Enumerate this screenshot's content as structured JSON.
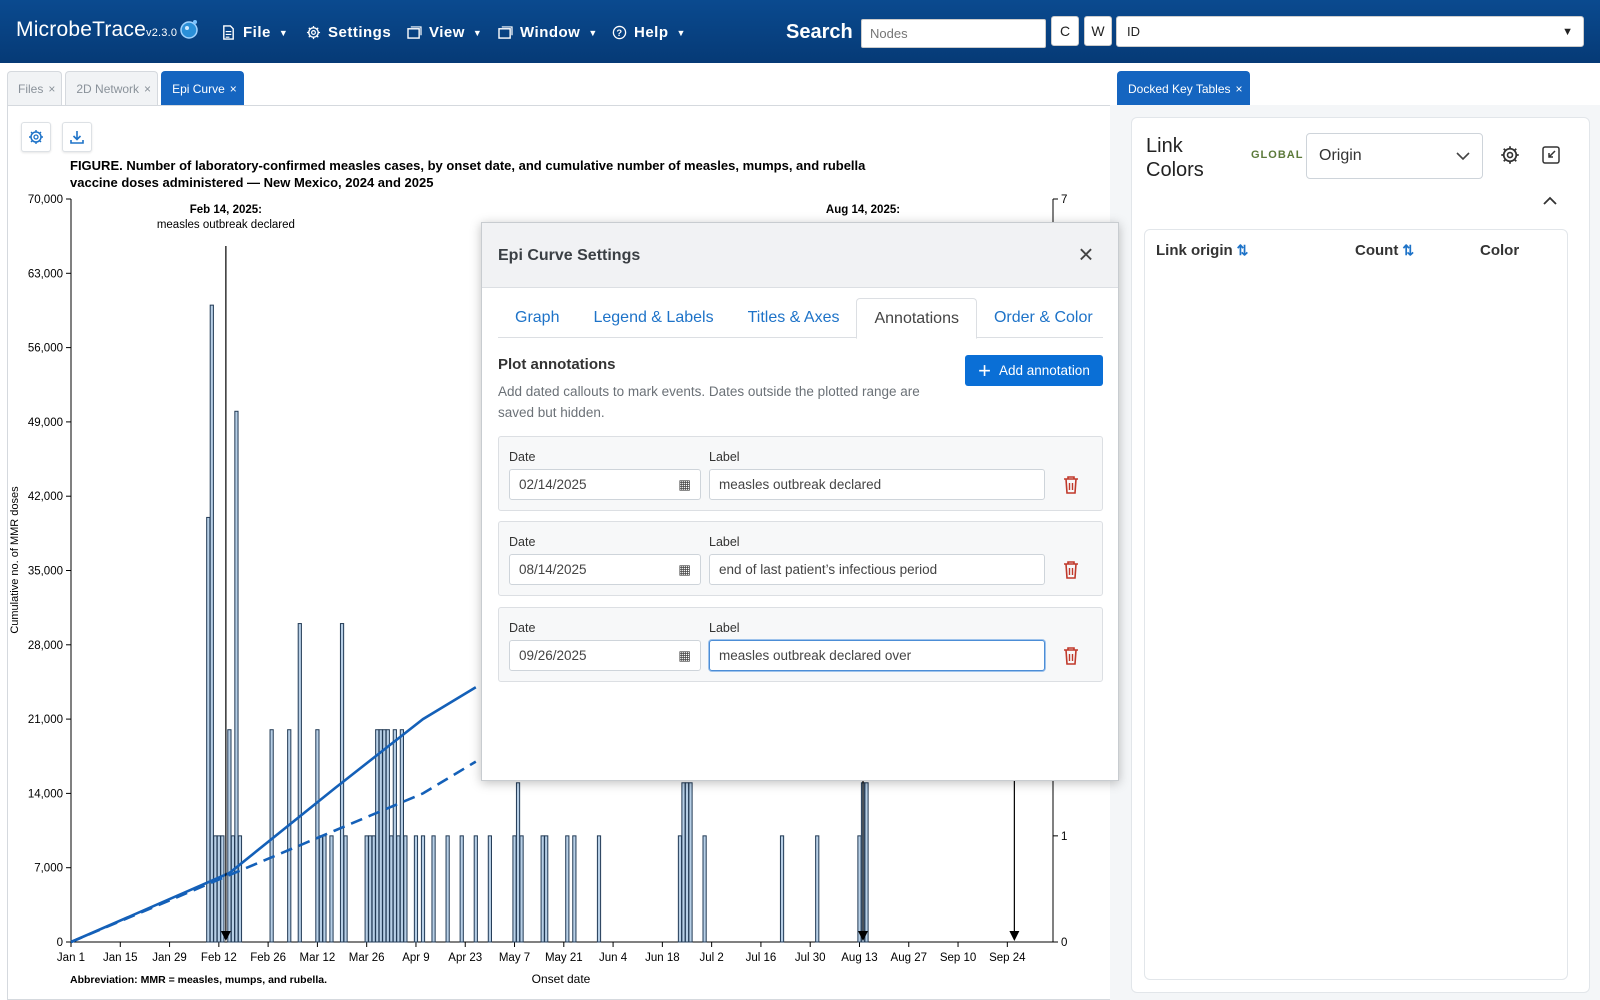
{
  "navbar": {
    "brand": "MicrobeTrace",
    "version": "v2.3.0",
    "menus": [
      {
        "label": "File",
        "icon": "file-icon"
      },
      {
        "label": "Settings",
        "icon": "gear-icon"
      },
      {
        "label": "View",
        "icon": "window-icon"
      },
      {
        "label": "Window",
        "icon": "window-icon"
      },
      {
        "label": "Help",
        "icon": "help-icon"
      }
    ],
    "search_label": "Search",
    "search_placeholder": "Nodes",
    "c_button": "C",
    "w_button": "W",
    "field_value": "ID"
  },
  "tabs": [
    {
      "label": "Files",
      "active": false
    },
    {
      "label": "2D Network",
      "active": false
    },
    {
      "label": "Epi Curve",
      "active": true
    }
  ],
  "right_tab": "Docked Key Tables",
  "chart_data": {
    "type": "bar",
    "title_line1": "FIGURE. Number of laboratory-confirmed measles cases, by onset date, and cumulative number of measles, mumps, and rubella",
    "title_line2": "vaccine doses administered — New Mexico, 2024 and 2025",
    "ylabel": "Cumulative no. of MMR doses",
    "xlabel": "Onset date",
    "footnote": "Abbreviation: MMR = measles, mumps, and rubella.",
    "ylim_left": [
      0,
      70000
    ],
    "left_ticks": [
      "0",
      "7,000",
      "14,000",
      "21,000",
      "28,000",
      "35,000",
      "42,000",
      "49,000",
      "56,000",
      "63,000",
      "70,000"
    ],
    "ylim_right": [
      0,
      7
    ],
    "right_ticks": [
      "0",
      "1",
      "7"
    ],
    "x_ticks": [
      "Jan 1",
      "Jan 15",
      "Jan 29",
      "Feb 12",
      "Feb 26",
      "Mar 12",
      "Mar 26",
      "Apr 9",
      "Apr 23",
      "May 7",
      "May 21",
      "Jun 4",
      "Jun 18",
      "Jul 2",
      "Jul 16",
      "Jul 30",
      "Aug 13",
      "Aug 27",
      "Sep 10",
      "Sep 24"
    ],
    "annotations": [
      {
        "date": "Feb 14, 2025:",
        "label": "measles outbreak declared",
        "day": 44
      },
      {
        "date": "Aug 14, 2025:",
        "label": "",
        "day": 225
      },
      {
        "date": "",
        "label": "",
        "day": 268
      }
    ],
    "bars": [
      {
        "day": 39,
        "value": 40000
      },
      {
        "day": 40,
        "value": 60000
      },
      {
        "day": 41,
        "value": 10000
      },
      {
        "day": 42,
        "value": 10000
      },
      {
        "day": 43,
        "value": 10000
      },
      {
        "day": 45,
        "value": 20000
      },
      {
        "day": 46,
        "value": 10000
      },
      {
        "day": 47,
        "value": 50000
      },
      {
        "day": 48,
        "value": 10000
      },
      {
        "day": 57,
        "value": 20000
      },
      {
        "day": 62,
        "value": 20000
      },
      {
        "day": 65,
        "value": 30000
      },
      {
        "day": 70,
        "value": 20000
      },
      {
        "day": 71,
        "value": 10000
      },
      {
        "day": 72,
        "value": 10000
      },
      {
        "day": 74,
        "value": 10000
      },
      {
        "day": 77,
        "value": 30000
      },
      {
        "day": 78,
        "value": 10000
      },
      {
        "day": 84,
        "value": 10000
      },
      {
        "day": 85,
        "value": 10000
      },
      {
        "day": 86,
        "value": 10000
      },
      {
        "day": 87,
        "value": 20000
      },
      {
        "day": 88,
        "value": 20000
      },
      {
        "day": 89,
        "value": 20000
      },
      {
        "day": 90,
        "value": 20000
      },
      {
        "day": 91,
        "value": 10000
      },
      {
        "day": 92,
        "value": 20000
      },
      {
        "day": 93,
        "value": 10000
      },
      {
        "day": 94,
        "value": 20000
      },
      {
        "day": 95,
        "value": 10000
      },
      {
        "day": 98,
        "value": 10000
      },
      {
        "day": 100,
        "value": 10000
      },
      {
        "day": 103,
        "value": 10000
      },
      {
        "day": 107,
        "value": 10000
      },
      {
        "day": 111,
        "value": 10000
      },
      {
        "day": 115,
        "value": 10000
      },
      {
        "day": 119,
        "value": 10000
      },
      {
        "day": 126,
        "value": 10000
      },
      {
        "day": 127,
        "value": 15000
      },
      {
        "day": 128,
        "value": 10000
      },
      {
        "day": 134,
        "value": 10000
      },
      {
        "day": 135,
        "value": 10000
      },
      {
        "day": 141,
        "value": 10000
      },
      {
        "day": 143,
        "value": 10000
      },
      {
        "day": 150,
        "value": 10000
      },
      {
        "day": 173,
        "value": 10000
      },
      {
        "day": 174,
        "value": 15000
      },
      {
        "day": 175,
        "value": 15000
      },
      {
        "day": 176,
        "value": 15000
      },
      {
        "day": 180,
        "value": 10000
      },
      {
        "day": 202,
        "value": 10000
      },
      {
        "day": 212,
        "value": 10000
      },
      {
        "day": 224,
        "value": 10000
      },
      {
        "day": 225,
        "value": 15000
      },
      {
        "day": 226,
        "value": 15000
      }
    ],
    "series": [
      {
        "style": "solid",
        "points": [
          [
            0,
            0
          ],
          [
            45,
            6500
          ],
          [
            75,
            14500
          ],
          [
            100,
            21000
          ],
          [
            115,
            24000
          ]
        ]
      },
      {
        "style": "dashed",
        "points": [
          [
            0,
            0
          ],
          [
            45,
            6300
          ],
          [
            75,
            10500
          ],
          [
            100,
            14000
          ],
          [
            115,
            17000
          ]
        ]
      }
    ]
  },
  "modal": {
    "title": "Epi Curve Settings",
    "tabs": [
      "Graph",
      "Legend & Labels",
      "Titles & Axes",
      "Annotations",
      "Order & Color"
    ],
    "active_tab": "Annotations",
    "section_title": "Plot annotations",
    "section_desc": "Add dated callouts to mark events. Dates outside the plotted range are saved but hidden.",
    "add_button": "Add annotation",
    "date_label": "Date",
    "label_label": "Label",
    "annotations": [
      {
        "date": "02/14/2025",
        "label": "measles outbreak declared"
      },
      {
        "date": "08/14/2025",
        "label": "end of last patient’s infectious period"
      },
      {
        "date": "09/26/2025",
        "label": "measles outbreak declared over"
      }
    ]
  },
  "link_colors": {
    "title": "Link Colors",
    "scope": "GLOBAL",
    "variable": "Origin",
    "columns": [
      "Link origin",
      "Count",
      "Color"
    ]
  }
}
